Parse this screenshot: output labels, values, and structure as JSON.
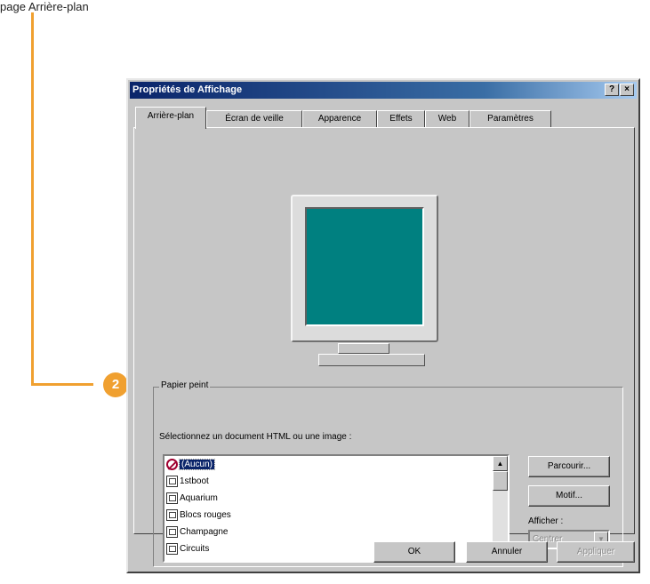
{
  "page": {
    "caption": "page Arrière-plan"
  },
  "callout": {
    "number": "2",
    "color": "#f0a030"
  },
  "dialog": {
    "title": "Propriétés de Affichage",
    "help_button": "?",
    "close_button": "×",
    "tabs": [
      {
        "label": "Arrière-plan",
        "active": true
      },
      {
        "label": "Écran de veille"
      },
      {
        "label": "Apparence"
      },
      {
        "label": "Effets"
      },
      {
        "label": "Web"
      },
      {
        "label": "Paramètres"
      }
    ],
    "preview": {
      "screen_color": "#008080"
    },
    "wallpaper": {
      "group_label": "Papier peint",
      "select_label": "Sélectionnez un document HTML ou une image :",
      "items": [
        {
          "label": "(Aucun)",
          "icon": "none-icon",
          "selected": true
        },
        {
          "label": "1stboot",
          "icon": "document-icon"
        },
        {
          "label": "Aquarium",
          "icon": "document-icon"
        },
        {
          "label": "Blocs rouges",
          "icon": "document-icon"
        },
        {
          "label": "Champagne",
          "icon": "document-icon"
        },
        {
          "label": "Circuits",
          "icon": "document-icon"
        }
      ],
      "browse_button": "Parcourir...",
      "pattern_button": "Motif...",
      "display_label": "Afficher :",
      "display_value": "Centrer"
    },
    "buttons": {
      "ok": "OK",
      "cancel": "Annuler",
      "apply": "Appliquer"
    }
  }
}
